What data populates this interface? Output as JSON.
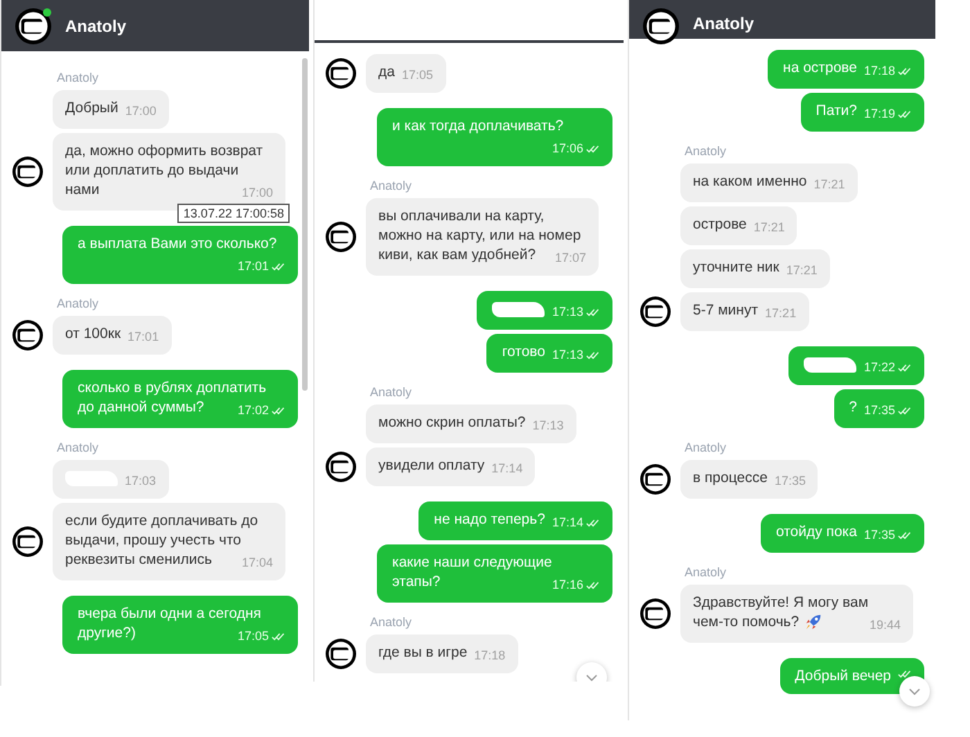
{
  "panels": [
    {
      "header": {
        "name": "Anatoly",
        "online": true
      },
      "scrollbar": true,
      "messages": [
        {
          "kind": "sender",
          "text": "Anatoly"
        },
        {
          "kind": "in",
          "text": "Добрый",
          "time": "17:00"
        },
        {
          "kind": "in",
          "text": "да, можно оформить возврат или доплатить до выдачи нами",
          "time": "17:00",
          "avatar": true,
          "tooltip": "13.07.22 17:00:58"
        },
        {
          "kind": "out",
          "text": "а выплата Вами это сколько?",
          "time": "17:01",
          "read": true
        },
        {
          "kind": "sender",
          "text": "Anatoly"
        },
        {
          "kind": "in",
          "text": "от 100кк",
          "time": "17:01",
          "avatar": true
        },
        {
          "kind": "out",
          "text": "сколько в рублях доплатить до данной суммы?",
          "time": "17:02",
          "read": true
        },
        {
          "kind": "sender",
          "text": "Anatoly"
        },
        {
          "kind": "in",
          "redacted": true,
          "time": "17:03"
        },
        {
          "kind": "in",
          "text": "если будите доплачивать до выдачи, прошу учесть что реквезиты сменились",
          "time": "17:04",
          "avatar": true
        },
        {
          "kind": "out",
          "text": "вчера были одни а сегодня другие?)",
          "time": "17:05",
          "read": true
        }
      ]
    },
    {
      "scroll_button": true,
      "messages": [
        {
          "kind": "in",
          "text": "да",
          "time": "17:05",
          "avatar": true
        },
        {
          "kind": "out",
          "text": "и как тогда доплачивать?",
          "time": "17:06",
          "read": true
        },
        {
          "kind": "sender",
          "text": "Anatoly"
        },
        {
          "kind": "in",
          "text": "вы оплачивали на карту, можно на карту, или на номер киви, как вам удобней?",
          "time": "17:07",
          "avatar": true
        },
        {
          "kind": "out",
          "redacted": true,
          "time": "17:13",
          "read": true
        },
        {
          "kind": "out",
          "text": "готово",
          "time": "17:13",
          "read": true
        },
        {
          "kind": "sender",
          "text": "Anatoly"
        },
        {
          "kind": "in",
          "text": "можно скрин оплаты?",
          "time": "17:13"
        },
        {
          "kind": "in",
          "text": "увидели оплату",
          "time": "17:14",
          "avatar": true
        },
        {
          "kind": "out",
          "text": "не надо теперь?",
          "time": "17:14",
          "read": true
        },
        {
          "kind": "out",
          "text": "какие наши следующие этапы?",
          "time": "17:16",
          "read": true
        },
        {
          "kind": "sender",
          "text": "Anatoly"
        },
        {
          "kind": "in",
          "text": "где вы в игре",
          "time": "17:18",
          "avatar": true
        }
      ]
    },
    {
      "header": {
        "name": "Anatoly"
      },
      "scroll_button": true,
      "messages": [
        {
          "kind": "out",
          "text": "на острове",
          "time": "17:18",
          "read": true
        },
        {
          "kind": "out",
          "text": "Пати?",
          "time": "17:19",
          "read": true
        },
        {
          "kind": "sender",
          "text": "Anatoly"
        },
        {
          "kind": "in",
          "text": "на каком именно",
          "time": "17:21"
        },
        {
          "kind": "in",
          "text": "острове",
          "time": "17:21"
        },
        {
          "kind": "in",
          "text": "уточните ник",
          "time": "17:21"
        },
        {
          "kind": "in",
          "text": "5-7 минут",
          "time": "17:21",
          "avatar": true
        },
        {
          "kind": "out",
          "redacted": true,
          "time": "17:22",
          "read": true
        },
        {
          "kind": "out",
          "text": "?",
          "time": "17:35",
          "read": true
        },
        {
          "kind": "sender",
          "text": "Anatoly"
        },
        {
          "kind": "in",
          "text": "в процессе",
          "time": "17:35",
          "avatar": true
        },
        {
          "kind": "out",
          "text": "отойду пока",
          "time": "17:35",
          "read": true
        },
        {
          "kind": "sender",
          "text": "Anatoly"
        },
        {
          "kind": "in",
          "text": "Здравствуйте! Я могу вам чем-то помочь?",
          "time": "19:44",
          "avatar": true,
          "has_icon": true
        },
        {
          "kind": "out",
          "text": "Добрый вечер",
          "read": true
        }
      ]
    }
  ]
}
